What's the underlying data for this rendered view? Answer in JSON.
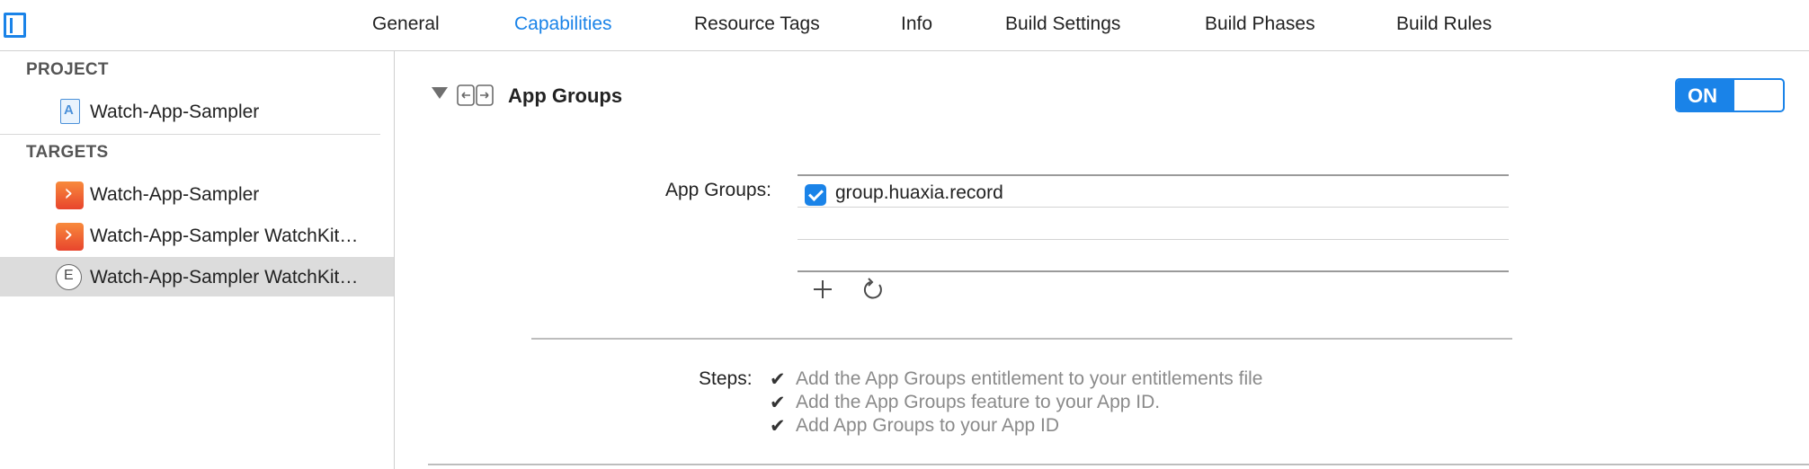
{
  "tabs": [
    {
      "label": "General",
      "active": false
    },
    {
      "label": "Capabilities",
      "active": true
    },
    {
      "label": "Resource Tags",
      "active": false
    },
    {
      "label": "Info",
      "active": false
    },
    {
      "label": "Build Settings",
      "active": false
    },
    {
      "label": "Build Phases",
      "active": false
    },
    {
      "label": "Build Rules",
      "active": false
    }
  ],
  "sidebar": {
    "project_header": "PROJECT",
    "project_item": {
      "label": "Watch-App-Sampler",
      "icon": "project-icon"
    },
    "targets_header": "TARGETS",
    "targets": [
      {
        "label": "Watch-App-Sampler",
        "icon": "swift-app-icon",
        "selected": false
      },
      {
        "label": "Watch-App-Sampler WatchKit…",
        "icon": "swift-app-icon",
        "selected": false
      },
      {
        "label": "Watch-App-Sampler WatchKit…",
        "icon": "extension-icon",
        "selected": true
      }
    ]
  },
  "capability": {
    "title": "App Groups",
    "toggle_label": "ON",
    "field_label": "App Groups:",
    "groups": [
      {
        "name": "group.huaxia.record",
        "checked": true
      }
    ],
    "add_icon": "plus-icon",
    "refresh_icon": "refresh-icon",
    "steps_label": "Steps:",
    "steps": [
      "Add the App Groups entitlement to your entitlements file",
      "Add the App Groups feature to your App ID.",
      "Add App Groups to your App ID"
    ]
  },
  "colors": {
    "accent": "#1a83e8",
    "selected_row": "#dcdcdc",
    "step_text": "#8a8a8a"
  }
}
